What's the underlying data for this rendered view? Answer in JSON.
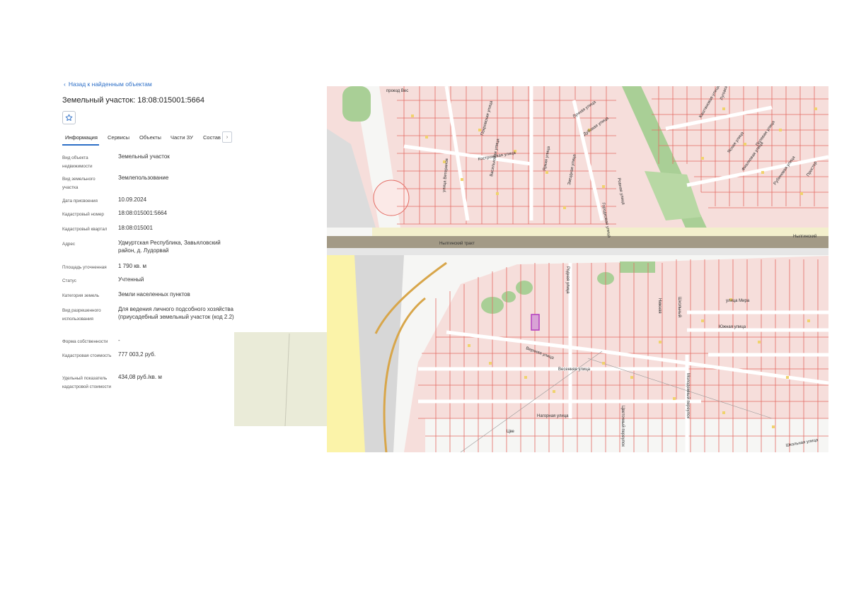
{
  "panel": {
    "back_link": "Назад к найденным объектам",
    "title": "Земельный участок: 18:08:015001:5664",
    "tabs": [
      "Информация",
      "Сервисы",
      "Объекты",
      "Части ЗУ",
      "Состав"
    ],
    "active_tab": "Информация",
    "tab_more": "›",
    "rows": [
      {
        "label": "Вид объекта недвижимости",
        "value": "Земельный участок"
      },
      {
        "label": "Вид земельного участка",
        "value": "Землепользование"
      },
      {
        "label": "Дата присвоения",
        "value": "10.09.2024"
      },
      {
        "label": "Кадастровый номер",
        "value": "18:08:015001:5664"
      },
      {
        "label": "Кадастровый квартал",
        "value": "18:08:015001"
      },
      {
        "label": "Адрес",
        "value": "Удмуртская Республика, Завьяловский район, д. Лудорвай"
      },
      {
        "label": "Площадь уточненная",
        "value": "1 790 кв. м"
      },
      {
        "label": "Статус",
        "value": "Учтенный"
      },
      {
        "label": "Категория земель",
        "value": "Земли населенных пунктов"
      },
      {
        "label": "Вид разрешенного использования",
        "value": "Для ведения личного подсобного хозяйства (приусадебный земельный участок (код 2.2)"
      },
      {
        "label": "Форма собственности",
        "value": "-"
      },
      {
        "label": "Кадастровая стоимость",
        "value": "777 003,2 руб."
      },
      {
        "label": "Удельный показатель кадастровой стоимости",
        "value": "434,08 руб./кв. м"
      }
    ]
  },
  "map": {
    "streets": {
      "nylginsky_trakt_left": "Нылгинский тракт",
      "nylginsky_trakt_right": "Нылгинский",
      "proezd": "проезд Вес",
      "ulitsa_mira": "улица Мира",
      "yuzhnaya": "Южная улица",
      "verkhnyaya": "Верхняя улица",
      "vesennyaya": "Весенняя улица",
      "nagornaya": "Нагорная улица",
      "shkolnaya": "Школьная улица",
      "molodezhny": "Молодежный переулок",
      "tsvetochny": "Цветочный переулок",
      "pokrovskaya": "Покровская улица",
      "lunnaya": "Лунная улица",
      "dubovaya": "Дубовая улица",
      "zvezdnaya": "Звездная улица",
      "vasilkovaya": "Васильковая улица",
      "yarkaya": "Яркая улица",
      "kostromskaya": "Костромская улица",
      "ulitsa_veteranov": "улица Ветеранов",
      "rodnaya": "Родная улица",
      "rovnaya": "Ровная улица",
      "gorodkovaya": "Городковая улица",
      "prostornaya": "Простор",
      "kashtanovaya": "Каштановая улица",
      "yasnaya": "Ясная улица",
      "fialkovaya": "Фиалковая улица",
      "rubinovaya": "Рубиновая улица",
      "polevaya": "Полевая улица",
      "nizhnyaya": "Нижняя",
      "shkolny": "Школьный",
      "tsv": "Цве",
      "lugovoy": "Луговой"
    },
    "colors": {
      "parcel_fill": "#f6dedb",
      "parcel_line": "#e46c64",
      "highlight": "#b23cbf",
      "road": "#e8e8e8",
      "trakt": "#a39a86",
      "forest": "#a9cf96",
      "yellow_zone": "#fbf3a9",
      "overlay": "#eaebd8",
      "building": "#f0d36d"
    }
  }
}
